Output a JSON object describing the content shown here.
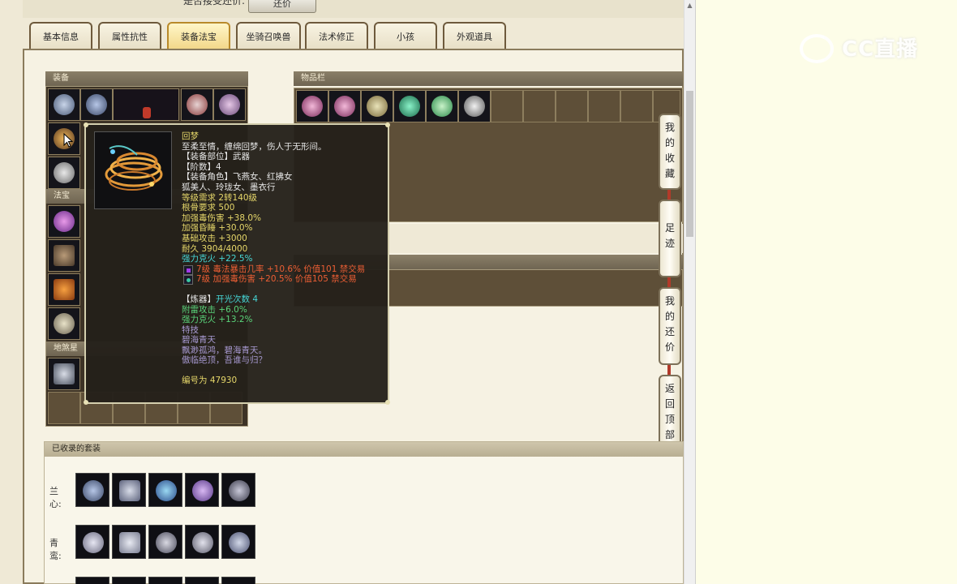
{
  "bargain": {
    "label": "是否接受还价:",
    "button": "还价"
  },
  "tabs": [
    "基本信息",
    "属性抗性",
    "装备法宝",
    "坐骑召唤兽",
    "法术修正",
    "小孩",
    "外观道具"
  ],
  "active_tab": 2,
  "sections": {
    "equipment": "装备",
    "treasure": "法宝",
    "fengshui": "地煞星",
    "inventory": "物品栏",
    "sets": "已收录的套装"
  },
  "tooltip": {
    "name": "回梦",
    "desc": "至柔至情，缠绵回梦，伤人于无形间。",
    "slot": "【装备部位】武器",
    "tier": "【阶数】4",
    "roles_1": "【装备角色】飞燕女、红拂女",
    "roles_2": "狐美人、玲珑女、墨衣行",
    "level_req": "等级需求 2转140级",
    "bone_req": "根骨要求 500",
    "attr1": "加强毒伤害 +38.0%",
    "attr2": "加强昏睡 +30.0%",
    "attr3": "基础攻击 +3000",
    "durability": "耐久 3904/4000",
    "resist": "强力克火 +22.5%",
    "gem1": "7级 毒法暴击几率 +10.6% 价值101 禁交易",
    "gem2": "7级 加强毒伤害 +20.5% 价值105 禁交易",
    "refine_label": "【炼器】",
    "refine_count": "开光次数 4",
    "refine1": "附雷攻击 +6.0%",
    "refine2": "强力克火 +13.2%",
    "skill_label": "特技",
    "skill_name": "碧海青天",
    "poem1": "飘渺孤鸿，碧海青天。",
    "poem2": "傲临绝顶，吾谁与归？",
    "serial": "编号为 47930"
  },
  "side_buttons": [
    "我的收藏",
    "足迹",
    "我的还价",
    "返回顶部"
  ],
  "sets": [
    {
      "label": "兰心:"
    },
    {
      "label": "青鸾:"
    }
  ],
  "watermark": "CC直播",
  "colors": {
    "tab_active": "#f2d788",
    "tooltip_bg": "#24201a",
    "gold_text": "#e6d76a",
    "cyan_text": "#46d6d6",
    "red_text": "#ec5e34"
  }
}
